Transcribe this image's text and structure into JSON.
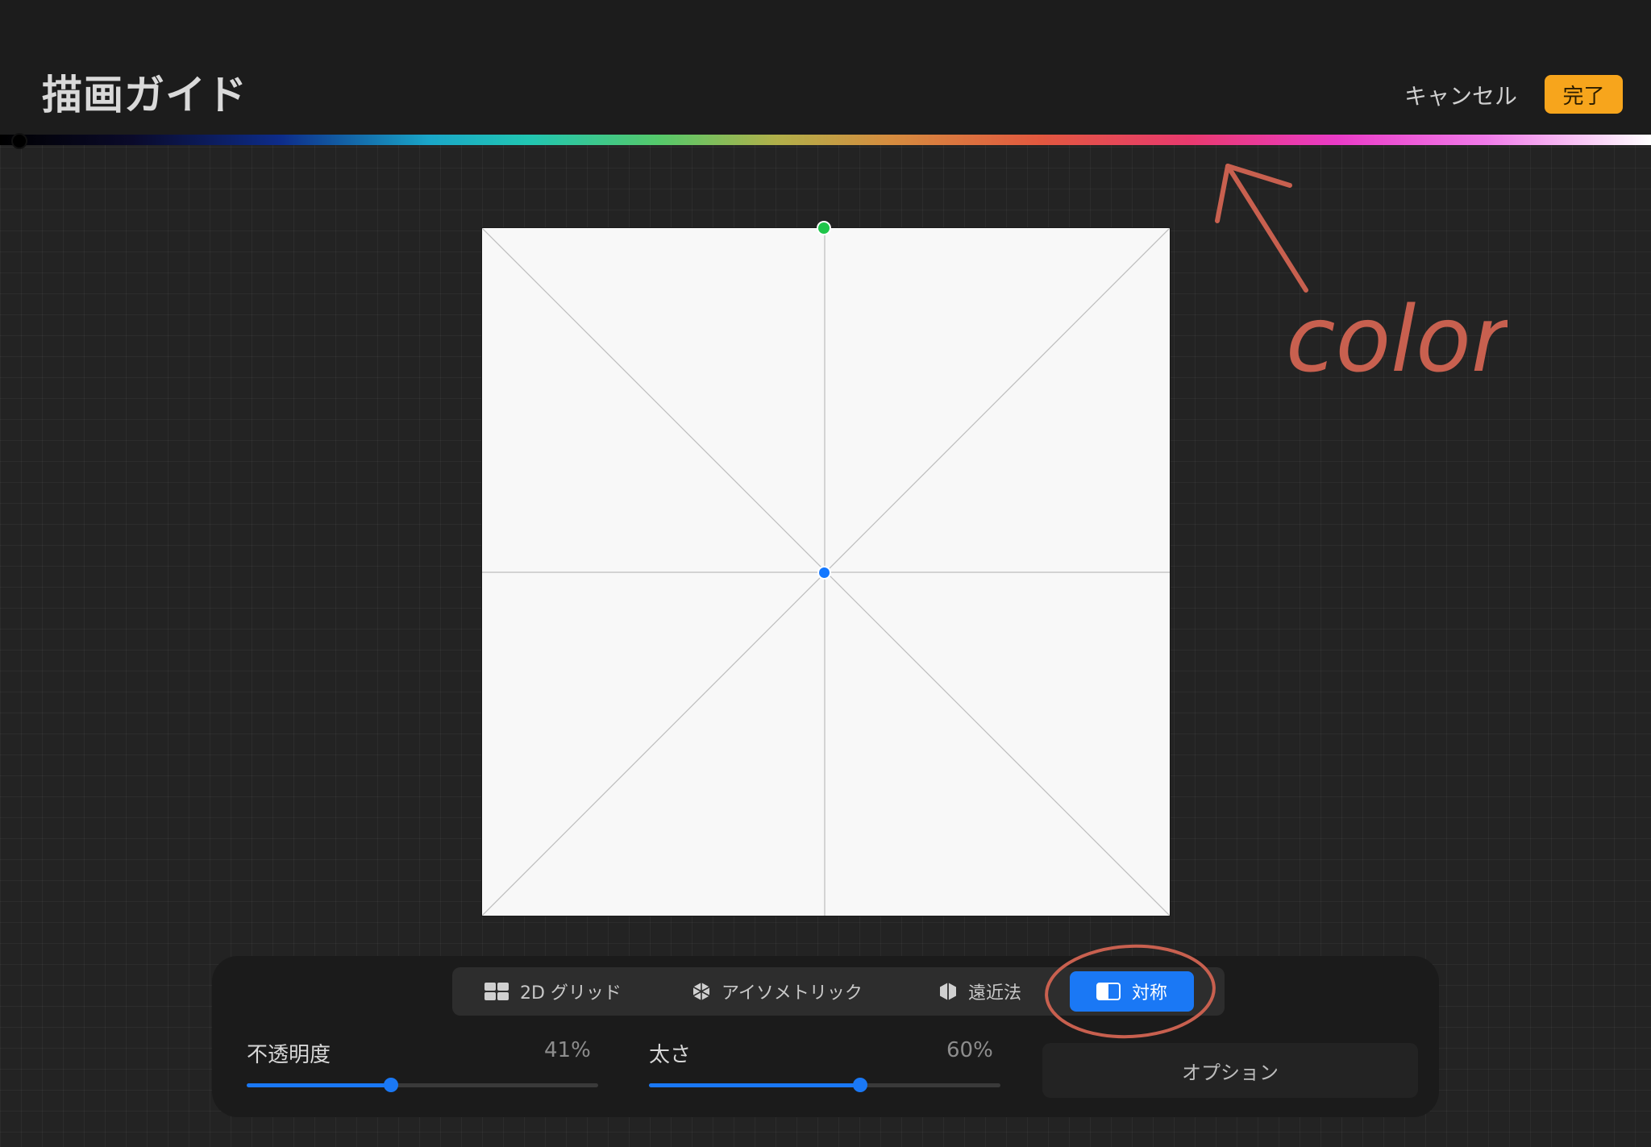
{
  "header": {
    "title": "描画ガイド",
    "cancel_label": "キャンセル",
    "done_label": "完了"
  },
  "color_bar": {
    "selected_color": "#000000"
  },
  "annotation": {
    "text": "color",
    "color": "#c8604f"
  },
  "guide_modes": [
    {
      "label": "2D グリッド",
      "icon": "grid-icon",
      "active": false
    },
    {
      "label": "アイソメトリック",
      "icon": "isometric-icon",
      "active": false
    },
    {
      "label": "遠近法",
      "icon": "perspective-icon",
      "active": false
    },
    {
      "label": "対称",
      "icon": "symmetry-icon",
      "active": true
    }
  ],
  "sliders": {
    "opacity": {
      "label": "不透明度",
      "value_text": "41%",
      "value": 0.41
    },
    "thickness": {
      "label": "太さ",
      "value_text": "60%",
      "value": 0.6
    }
  },
  "options_label": "オプション",
  "colors": {
    "accent_blue": "#1a78f5",
    "done_orange": "#f7a51c",
    "handle_green": "#1fc54a"
  }
}
